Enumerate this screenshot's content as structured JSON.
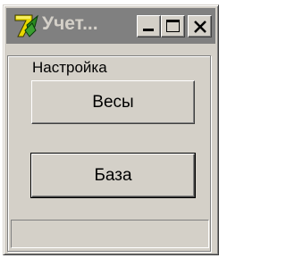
{
  "window": {
    "title": "Учет...",
    "icon": "app-logo-icon",
    "caption_buttons": {
      "minimize_icon": "minimize-icon",
      "maximize_icon": "maximize-icon",
      "close_icon": "close-icon"
    }
  },
  "settings_group": {
    "label": "Настройка",
    "buttons": {
      "scales_label": "Весы",
      "base_label": "База"
    }
  },
  "status_bar": {
    "text": ""
  },
  "colors": {
    "face": "#d4d0c8",
    "titlebar_inactive": "#808080",
    "highlight": "#ffffff",
    "shadow": "#808080"
  }
}
